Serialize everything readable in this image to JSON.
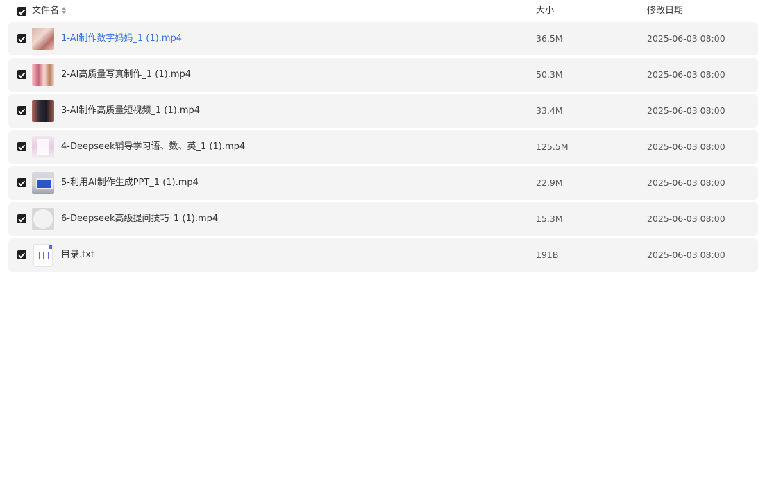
{
  "header": {
    "name_label": "文件名",
    "size_label": "大小",
    "date_label": "修改日期"
  },
  "files": [
    {
      "name": "1-AI制作数字妈妈_1 (1).mp4",
      "size": "36.5M",
      "date": "2025-06-03 08:00",
      "icon": "video-thumbnail-icon",
      "highlighted": true,
      "checked": true
    },
    {
      "name": "2-AI高质量写真制作_1 (1).mp4",
      "size": "50.3M",
      "date": "2025-06-03 08:00",
      "icon": "video-thumbnail-icon",
      "highlighted": false,
      "checked": true
    },
    {
      "name": "3-AI制作高质量短视频_1 (1).mp4",
      "size": "33.4M",
      "date": "2025-06-03 08:00",
      "icon": "video-thumbnail-icon",
      "highlighted": false,
      "checked": true
    },
    {
      "name": "4-Deepseek辅导学习语、数、英_1 (1).mp4",
      "size": "125.5M",
      "date": "2025-06-03 08:00",
      "icon": "video-thumbnail-icon",
      "highlighted": false,
      "checked": true
    },
    {
      "name": "5-利用AI制作生成PPT_1 (1).mp4",
      "size": "22.9M",
      "date": "2025-06-03 08:00",
      "icon": "video-thumbnail-icon",
      "highlighted": false,
      "checked": true
    },
    {
      "name": "6-Deepseek高级提问技巧_1 (1).mp4",
      "size": "15.3M",
      "date": "2025-06-03 08:00",
      "icon": "video-thumbnail-icon",
      "highlighted": false,
      "checked": true
    },
    {
      "name": "目录.txt",
      "size": "191B",
      "date": "2025-06-03 08:00",
      "icon": "text-file-icon",
      "highlighted": false,
      "checked": true
    }
  ],
  "colors": {
    "link_active": "#2f6fe0",
    "row_background": "#f4f4f4",
    "checkbox": "#1f1f1f",
    "txt_icon_accent": "#5b6be0"
  }
}
